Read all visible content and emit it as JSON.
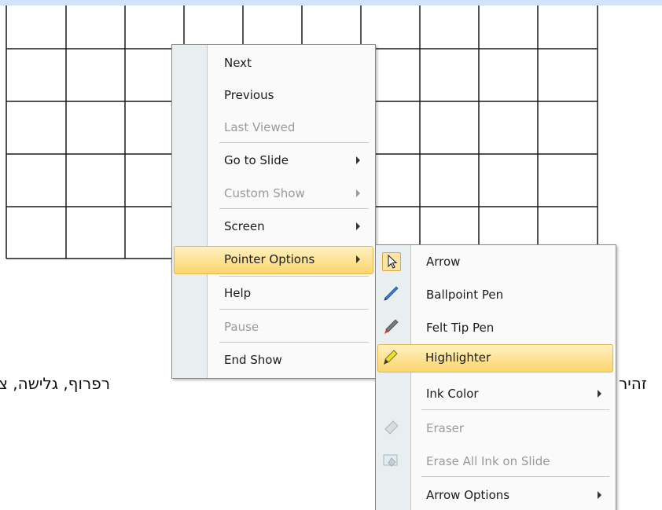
{
  "slide": {
    "text_right": "רפרוף, גלישה, צ'אט.",
    "text_left_fragment": "זהיר"
  },
  "main_menu": {
    "items": [
      {
        "label": "Next",
        "enabled": true,
        "submenu": false
      },
      {
        "label": "Previous",
        "enabled": true,
        "submenu": false
      },
      {
        "label": "Last Viewed",
        "enabled": false,
        "submenu": false
      },
      {
        "label": "Go to Slide",
        "enabled": true,
        "submenu": true
      },
      {
        "label": "Custom Show",
        "enabled": false,
        "submenu": true
      },
      {
        "label": "Screen",
        "enabled": true,
        "submenu": true
      },
      {
        "label": "Pointer Options",
        "enabled": true,
        "submenu": true,
        "highlighted": true
      },
      {
        "label": "Help",
        "enabled": true,
        "submenu": false
      },
      {
        "label": "Pause",
        "enabled": false,
        "submenu": false
      },
      {
        "label": "End Show",
        "enabled": true,
        "submenu": false
      }
    ]
  },
  "pointer_menu": {
    "items": [
      {
        "label": "Arrow",
        "icon": "arrow-cursor-icon",
        "enabled": true,
        "checked": true
      },
      {
        "label": "Ballpoint Pen",
        "icon": "ballpoint-pen-icon",
        "enabled": true
      },
      {
        "label": "Felt Tip Pen",
        "icon": "felt-tip-pen-icon",
        "enabled": true
      },
      {
        "label": "Highlighter",
        "icon": "highlighter-icon",
        "enabled": true,
        "highlighted": true
      },
      {
        "label": "Ink Color",
        "enabled": true,
        "submenu": true
      },
      {
        "label": "Eraser",
        "icon": "eraser-icon",
        "enabled": false
      },
      {
        "label": "Erase All Ink on Slide",
        "icon": "erase-all-icon",
        "enabled": false
      },
      {
        "label": "Arrow Options",
        "enabled": true,
        "submenu": true
      }
    ]
  },
  "colors": {
    "highlight_top": "#fef1c0",
    "highlight_bottom": "#fcd56d",
    "gutter": "#e9eef0",
    "top_bar": "#cfe4f7"
  }
}
